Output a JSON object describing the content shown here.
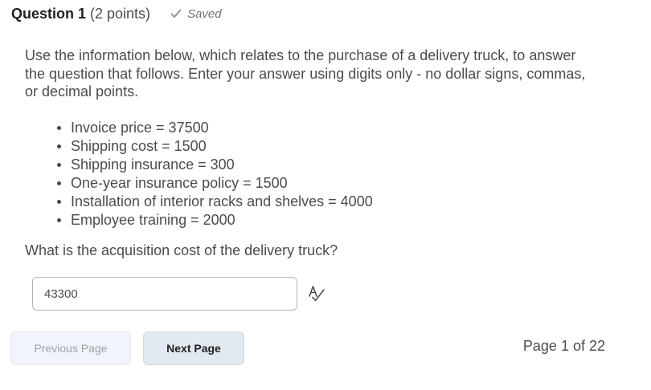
{
  "question": {
    "title": "Question 1",
    "points": "(2 points)",
    "status": "Saved",
    "intro": "Use the information below, which relates to the purchase of a delivery truck, to answer the question that follows. Enter your answer using digits only - no dollar signs, commas, or decimal points.",
    "items": [
      "Invoice price = 37500",
      "Shipping cost = 1500",
      "Shipping insurance = 300",
      "One-year insurance policy = 1500",
      "Installation of interior racks and shelves = 4000",
      "Employee training = 2000"
    ],
    "prompt": "What is the acquisition cost of the delivery truck?"
  },
  "answer": {
    "value": "43300"
  },
  "navigation": {
    "previous_label": "Previous Page",
    "next_label": "Next Page",
    "page_indicator": "Page 1 of 22"
  },
  "icons": {
    "saved": "check-icon",
    "spell_check": "spell-check-icon"
  },
  "colors": {
    "text": "#494c4e",
    "title": "#202122",
    "prev_button_bg": "#f1f5fb",
    "next_button_bg": "#e3e9f1",
    "input_border": "#b1b5b8"
  }
}
